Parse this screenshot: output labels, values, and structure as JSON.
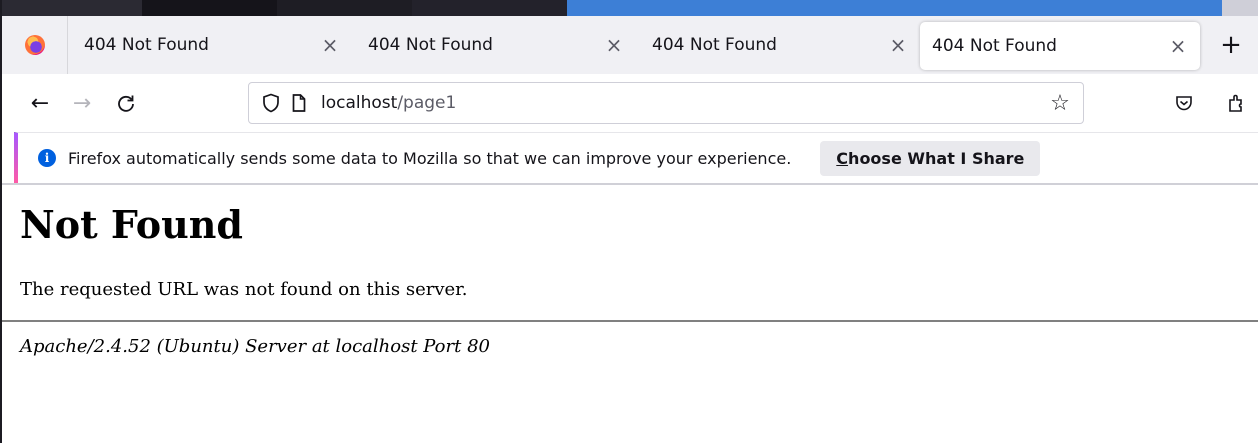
{
  "tabs": [
    {
      "title": "404 Not Found",
      "active": false
    },
    {
      "title": "404 Not Found",
      "active": false
    },
    {
      "title": "404 Not Found",
      "active": false
    },
    {
      "title": "404 Not Found",
      "active": true
    }
  ],
  "tab_close_glyph": "×",
  "new_tab_glyph": "+",
  "nav": {
    "back_glyph": "←",
    "forward_glyph": "→",
    "reload_glyph": "↻",
    "url_host": "localhost",
    "url_path": "/page1"
  },
  "notification": {
    "message": "Firefox automatically sends some data to Mozilla so that we can improve your experience.",
    "button_label_first": "C",
    "button_label_rest": "hoose What I Share",
    "info_glyph": "i"
  },
  "page": {
    "heading": "Not Found",
    "message": "The requested URL was not found on this server.",
    "server_signature": "Apache/2.4.52 (Ubuntu) Server at localhost Port 80"
  },
  "icons": {
    "firefox": "firefox-logo-icon",
    "shield": "tracking-protection-shield-icon",
    "page": "page-info-icon",
    "star": "bookmark-star-icon",
    "pocket": "pocket-icon",
    "extensions": "extensions-icon"
  },
  "colors": {
    "accent_blue": "#0060df",
    "notification_stripe": "#8e47d8",
    "tabbar_bg": "#f0f0f4"
  }
}
